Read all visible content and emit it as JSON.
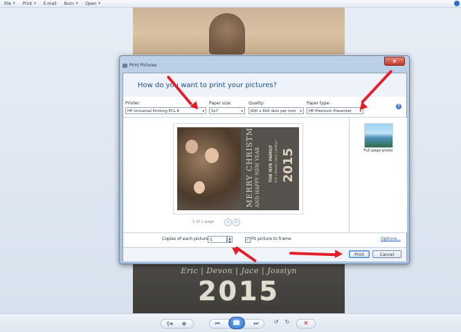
{
  "menubar": {
    "items": [
      {
        "label": "File",
        "caret": "▾"
      },
      {
        "label": "Print",
        "caret": "▾"
      },
      {
        "label": "E-mail",
        "caret": ""
      },
      {
        "label": "Burn",
        "caret": "▾"
      },
      {
        "label": "Open",
        "caret": "▾"
      }
    ]
  },
  "photo": {
    "names": "Eric | Devon | Jace | Jossiyn",
    "year": "2015"
  },
  "dialog": {
    "title": "Print Pictures",
    "close_glyph": "×",
    "question": "How do you want to print your pictures?",
    "printer": {
      "label": "Printer:",
      "value": "HP Universal Printing PCL 6"
    },
    "paper_size": {
      "label": "Paper size:",
      "value": "5x7"
    },
    "quality": {
      "label": "Quality:",
      "value": "600 x 600 dots per inch"
    },
    "paper_type": {
      "label": "Paper type:",
      "value": "HP Premium Presentat"
    },
    "dropdown_arrow": "▾",
    "help_glyph": "?",
    "card": {
      "line1": "MERRY CHRISTMAS",
      "line2": "AND HAPPY NEW YEAR",
      "family": "THE NYE FAMILY",
      "members": "Eric | Devon | Jace | Jossiyn",
      "year": "2015"
    },
    "pager": {
      "text": "1 of 1 page",
      "prev": "◂",
      "next": "▸"
    },
    "layout": {
      "label": "Full page photo"
    },
    "copies": {
      "label": "Copies of each picture:",
      "value": "1"
    },
    "spin": {
      "up": "▲",
      "down": "▼"
    },
    "fit": {
      "label": "Fit picture to frame",
      "checked": true,
      "check_glyph": "✓"
    },
    "options_link": "Options...",
    "print_button": "Print",
    "cancel_button": "Cancel"
  },
  "controls": {
    "zoom": "⚲▾",
    "fit": "✥",
    "prev": "⏮",
    "next": "⏭",
    "rotate_ccw": "↺",
    "rotate_cw": "↻",
    "delete": "✕"
  },
  "colors": {
    "accent": "#2f6fd0",
    "annotation_arrow": "#e3202a",
    "close_button": "#c0392b"
  }
}
